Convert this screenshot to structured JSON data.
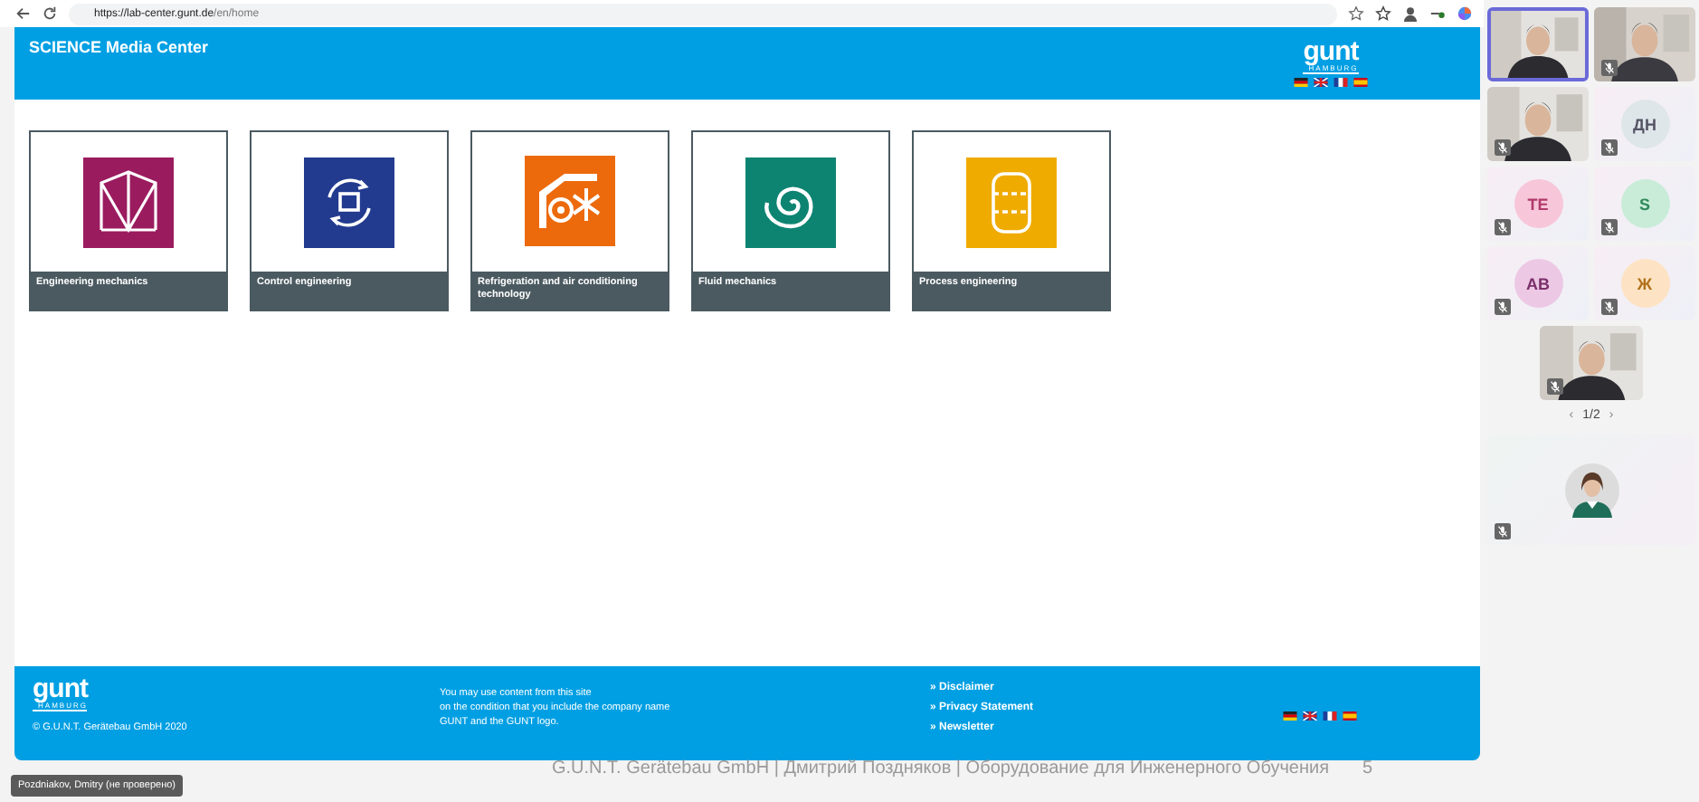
{
  "browser": {
    "url_host": "https://lab-center.gunt.de",
    "url_path": "/en/home"
  },
  "header": {
    "title": "SCIENCE Media Center",
    "logo": {
      "mark": "gunt",
      "city": "HAMBURG"
    }
  },
  "categories": [
    {
      "label": "Engineering mechanics",
      "kind": "truss",
      "color": "#9b1b5f"
    },
    {
      "label": "Control engineering",
      "kind": "cycle",
      "color": "#233b8f"
    },
    {
      "label": "Refrigeration and air conditioning technology",
      "kind": "fan",
      "color": "#ec6a0c"
    },
    {
      "label": "Fluid mechanics",
      "kind": "spiral",
      "color": "#0d8471"
    },
    {
      "label": "Process engineering",
      "kind": "tank",
      "color": "#efab00"
    }
  ],
  "footer": {
    "logo": {
      "mark": "gunt",
      "city": "HAMBURG"
    },
    "copyright": "© G.U.N.T. Gerätebau GmbH 2020",
    "notice": [
      "You may use content from this site",
      "on the condition that you include the company name",
      "GUNT and the GUNT logo."
    ],
    "links": [
      "» Disclaimer",
      "» Privacy Statement",
      "» Newsletter"
    ]
  },
  "meeting": {
    "tiles": [
      {
        "kind": "video",
        "selected": true,
        "muted": false
      },
      {
        "kind": "video",
        "selected": false,
        "muted": true
      },
      {
        "kind": "video",
        "selected": false,
        "muted": true
      },
      {
        "kind": "avatar",
        "initials": "ДН",
        "color": "#dfe6ea",
        "selected": false,
        "muted": true
      },
      {
        "kind": "avatar",
        "initials": "TE",
        "color": "#f7c6d9",
        "selected": false,
        "muted": true
      },
      {
        "kind": "avatar",
        "initials": "S",
        "color": "#c9ecd9",
        "selected": false,
        "muted": true
      },
      {
        "kind": "avatar",
        "initials": "AB",
        "color": "#ecc8e4",
        "selected": false,
        "muted": true
      },
      {
        "kind": "avatar",
        "initials": "Ж",
        "color": "#fde3c4",
        "selected": false,
        "muted": true
      },
      {
        "kind": "video",
        "selected": false,
        "muted": true
      }
    ],
    "pager_prev": "‹",
    "pager": "1/2",
    "pager_next": "›",
    "self": {
      "muted": true
    }
  },
  "presenter_label": "Pozdniakov, Dmitry (не проверено)",
  "share_title": "G.U.N.T. Gerätebau GmbH | Дмитрий Поздняков | Оборудование для Инженерного Обучения",
  "share_count": "5"
}
